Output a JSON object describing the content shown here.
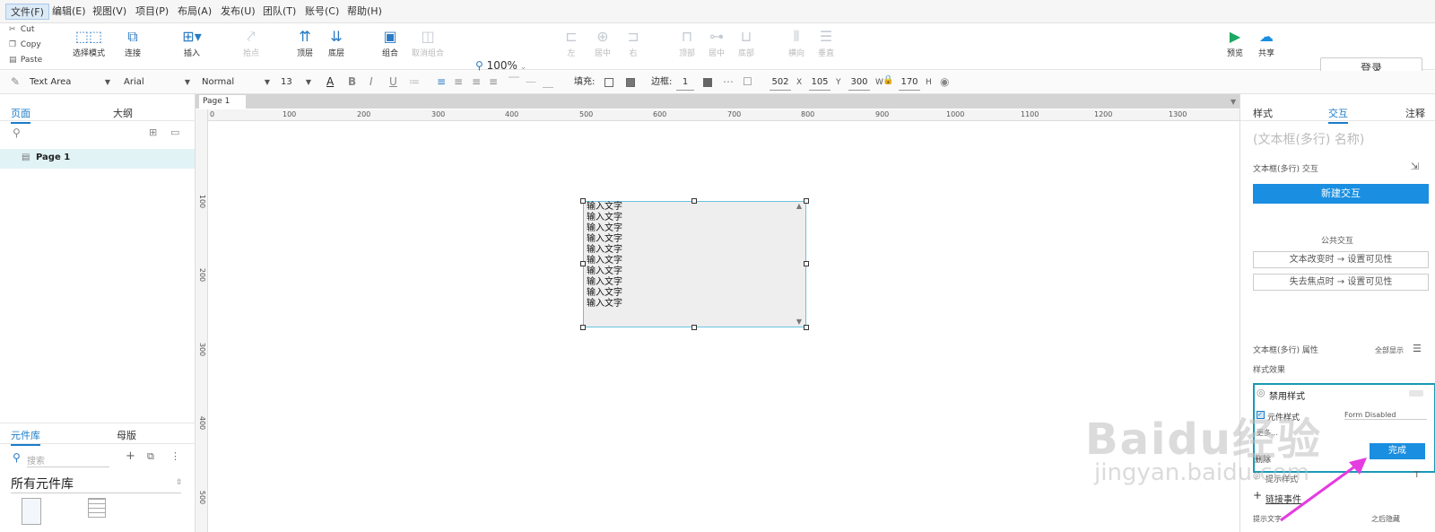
{
  "menu": [
    "文件(F)",
    "编辑(E)",
    "视图(V)",
    "项目(P)",
    "布局(A)",
    "发布(U)",
    "团队(T)",
    "账号(C)",
    "帮助(H)"
  ],
  "clipboard": {
    "cut": "Cut",
    "copy": "Copy",
    "paste": "Paste"
  },
  "toolbar": {
    "select_mode": "选择模式",
    "connect": "连接",
    "insert": "插入",
    "point": "拾点",
    "top": "顶层",
    "bottom": "底层",
    "group": "组合",
    "ungroup": "取消组合",
    "left": "左",
    "center": "居中",
    "right": "右",
    "align_top": "顶部",
    "align_middle": "居中",
    "align_bottom": "底部",
    "dist_h": "横向",
    "dist_v": "垂直",
    "preview": "预览",
    "share": "共享",
    "login": "登录"
  },
  "zoom": "100%",
  "format": {
    "widget_type": "Text Area",
    "font": "Arial",
    "weight": "Normal",
    "size": "13",
    "fill_label": "填充:",
    "border_label": "边框:",
    "border_width": "1",
    "x": "502",
    "x_lbl": "X",
    "y": "105",
    "y_lbl": "Y",
    "w": "300",
    "w_lbl": "W",
    "h": "170",
    "h_lbl": "H"
  },
  "left": {
    "tab_pages": "页面",
    "tab_outline": "大纲",
    "page_item": "Page 1",
    "tab_library": "元件库",
    "tab_masters": "母版",
    "search_placeholder": "搜索",
    "library_name": "所有元件库"
  },
  "doc_tab": "Page 1",
  "ruler_h": [
    "0",
    "100",
    "200",
    "300",
    "400",
    "500",
    "600",
    "700",
    "800",
    "900",
    "1000",
    "1100",
    "1200",
    "1300"
  ],
  "ruler_v": [
    "100",
    "200",
    "300",
    "400",
    "500"
  ],
  "textarea_lines": [
    "输入文字",
    "输入文字",
    "输入文字",
    "输入文字",
    "输入文字",
    "输入文字",
    "输入文字",
    "输入文字",
    "输入文字",
    "输入文字"
  ],
  "right": {
    "tab_style": "样式",
    "tab_interact": "交互",
    "tab_notes": "注释",
    "name_placeholder": "(文本框(多行) 名称)",
    "interactions_title": "文本框(多行) 交互",
    "new_interaction": "新建交互",
    "common_title": "公共交互",
    "common_1": "文本改变时 → 设置可见性",
    "common_2": "失去焦点时 → 设置可见性",
    "props_title": "文本框(多行) 属性",
    "show_all": "全部显示",
    "style_effects": "样式效果",
    "disable_style": "禁用样式",
    "widget_style": "元件样式",
    "widget_style_value": "Form Disabled",
    "more": "更多…",
    "delete": "删除",
    "done": "完成",
    "hint_style": "提示样式",
    "link_event": "链接事件",
    "hint_text": "提示文字",
    "after_hide": "之后隐藏"
  },
  "watermark": {
    "main": "Baidu经验",
    "sub": "jingyan.baidu.com"
  }
}
